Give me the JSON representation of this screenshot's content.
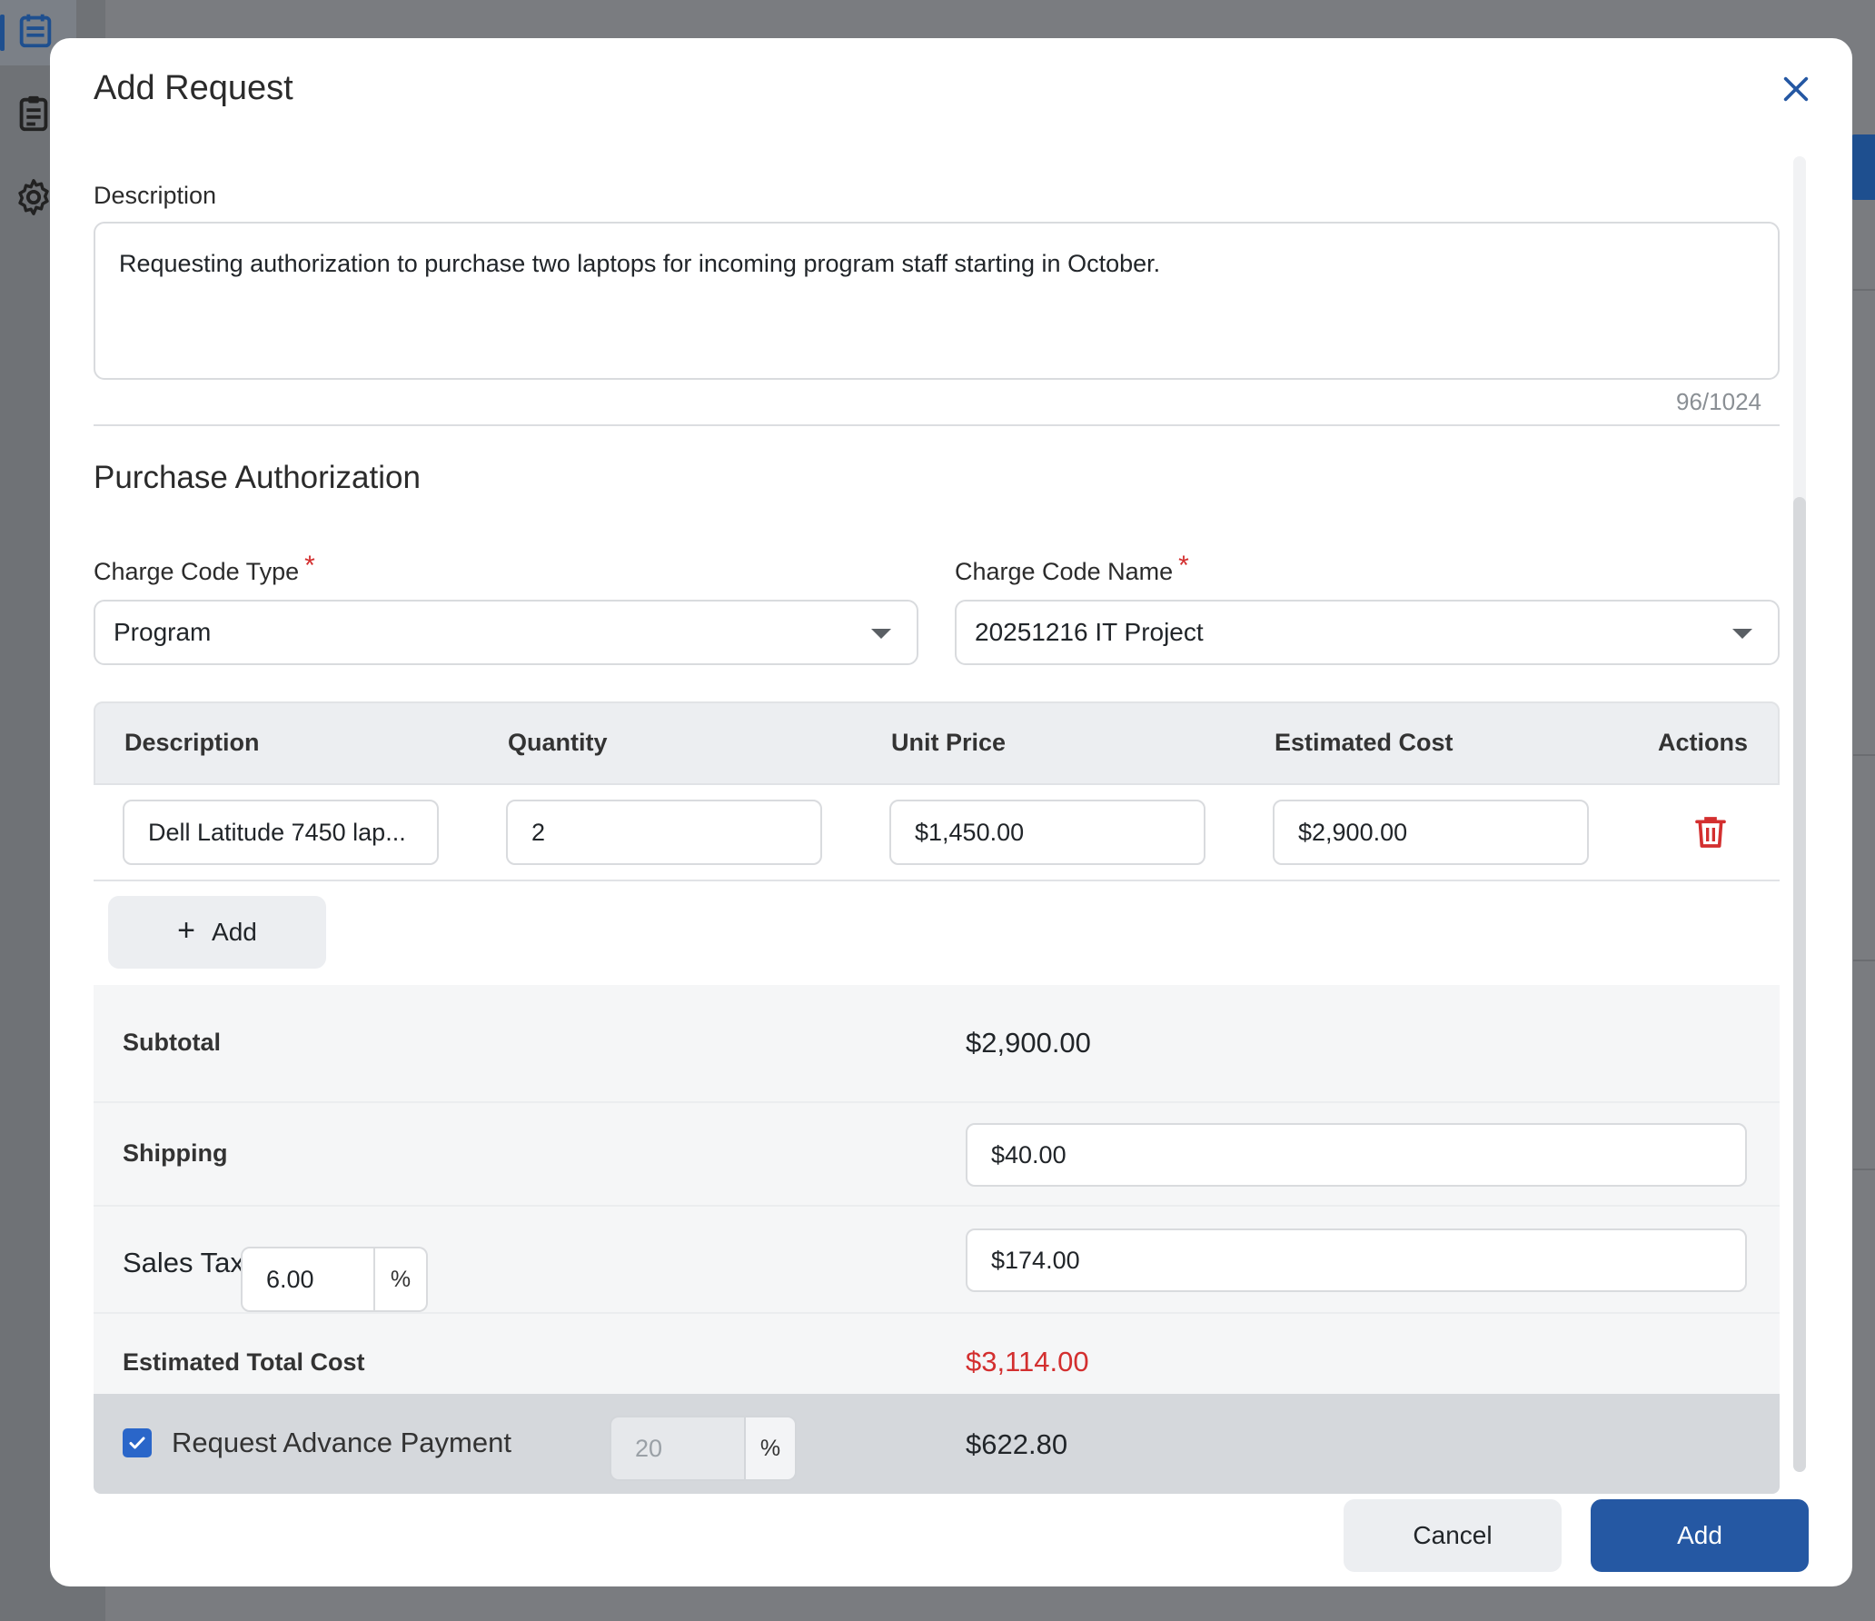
{
  "modal": {
    "title": "Add Request",
    "description_label": "Description",
    "description_value": "Requesting authorization to purchase two laptops for incoming program staff starting in October.",
    "char_counter": "96/1024",
    "section_title": "Purchase Authorization",
    "charge_code_type": {
      "label": "Charge Code Type",
      "required": "*",
      "value": "Program"
    },
    "charge_code_name": {
      "label": "Charge Code Name",
      "required": "*",
      "value": "20251216 IT Project"
    }
  },
  "items_table": {
    "headers": [
      "Description",
      "Quantity",
      "Unit Price",
      "Estimated Cost",
      "Actions"
    ],
    "rows": [
      {
        "description": "Dell Latitude 7450 lap...",
        "quantity": "2",
        "unit_price": "$1,450.00",
        "estimated_cost": "$2,900.00"
      }
    ],
    "add_label": "Add"
  },
  "summary": {
    "subtotal_label": "Subtotal",
    "subtotal_value": "$2,900.00",
    "shipping_label": "Shipping",
    "shipping_value": "$40.00",
    "sales_tax_label": "Sales Tax",
    "sales_tax_rate": "6.00",
    "percent_symbol": "%",
    "sales_tax_value": "$174.00",
    "total_label": "Estimated Total Cost",
    "total_value": "$3,114.00",
    "advance_label": "Request Advance Payment",
    "advance_checked": true,
    "advance_rate": "20",
    "advance_value": "$622.80"
  },
  "footer": {
    "cancel_label": "Cancel",
    "add_label": "Add"
  },
  "colors": {
    "accent": "#2558a3",
    "danger": "#d32f2f",
    "checkbox": "#2a66c9"
  },
  "icons": [
    "calendar-icon",
    "clipboard-icon",
    "gear-icon",
    "close-icon",
    "trash-icon",
    "plus-icon",
    "check-icon",
    "chevron-down-icon"
  ]
}
